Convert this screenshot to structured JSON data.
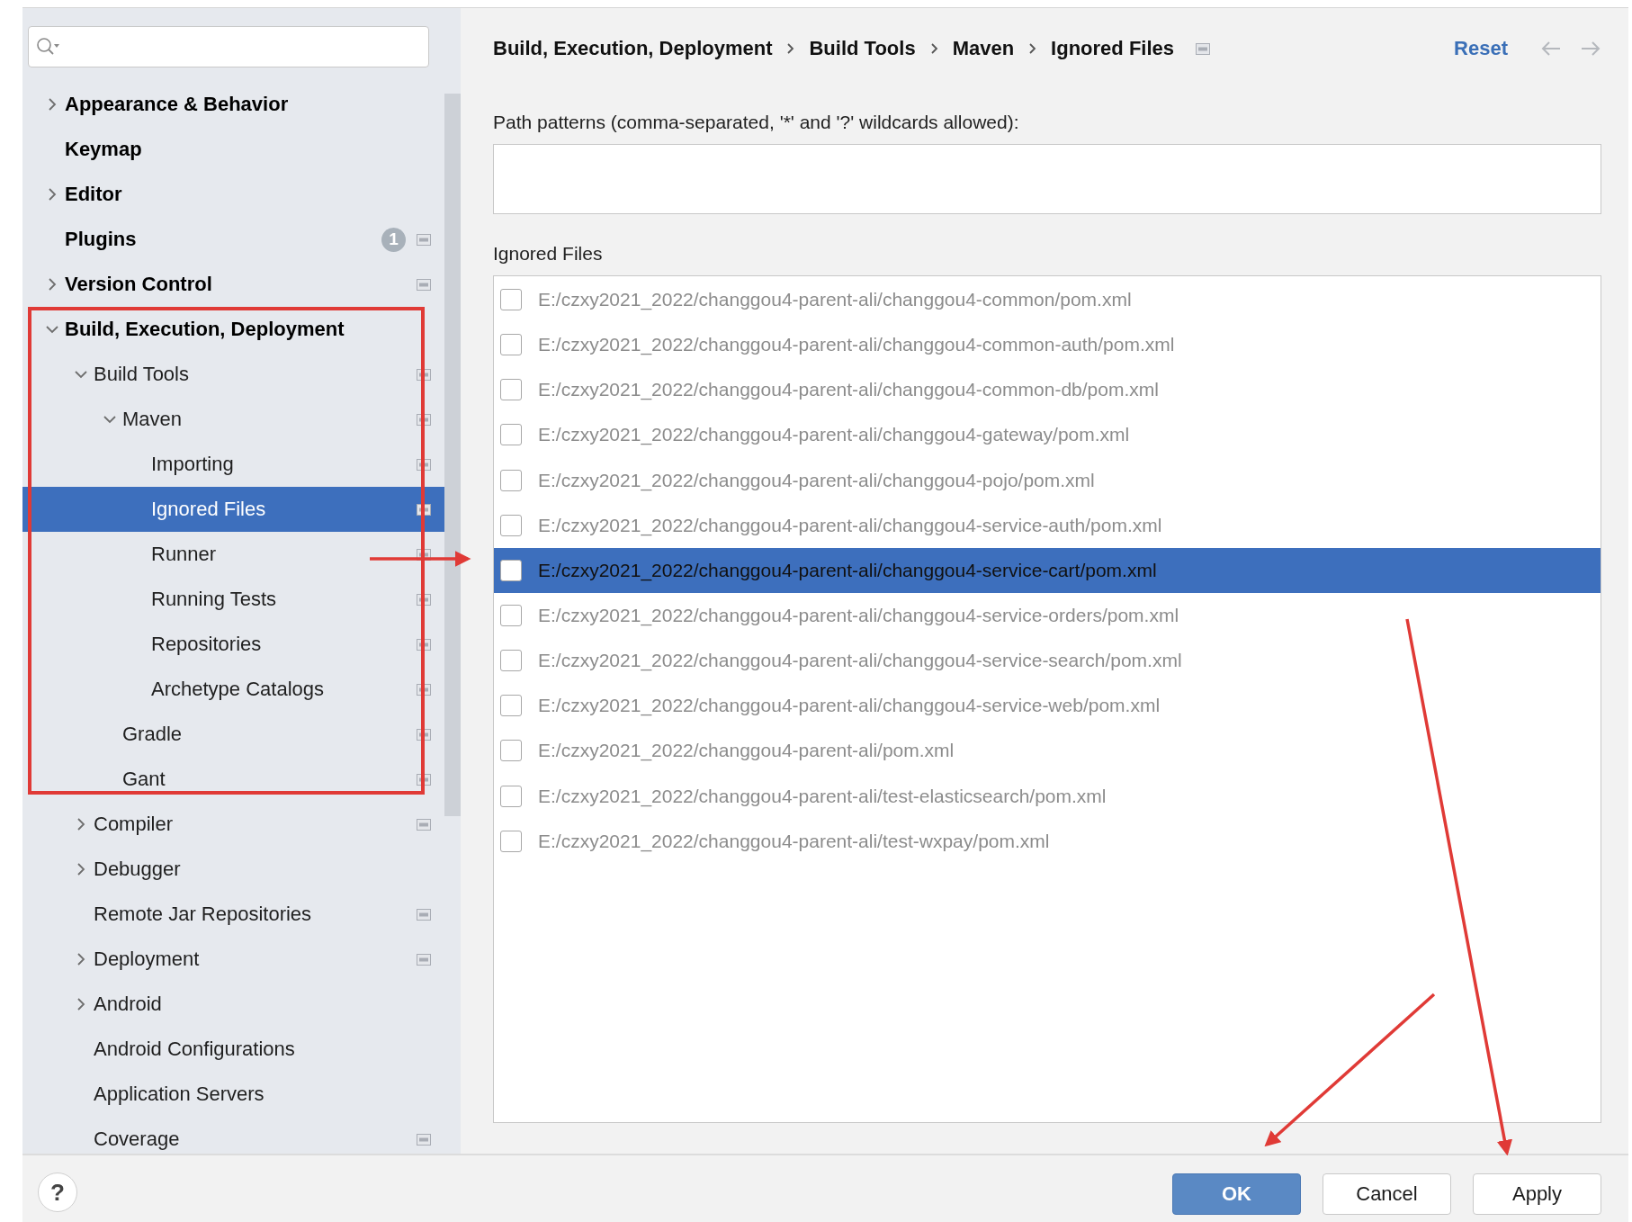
{
  "sidebar": {
    "items": [
      {
        "label": "Appearance & Behavior",
        "expanded": false,
        "selected": false,
        "project_icon": false
      },
      {
        "label": "Keymap",
        "selected": false,
        "project_icon": false
      },
      {
        "label": "Editor",
        "expanded": false,
        "selected": false,
        "project_icon": false
      },
      {
        "label": "Plugins",
        "badge": "1",
        "selected": false,
        "project_icon": true
      },
      {
        "label": "Version Control",
        "expanded": false,
        "selected": false,
        "project_icon": true
      },
      {
        "label": "Build, Execution, Deployment",
        "expanded": true,
        "selected": false,
        "project_icon": false,
        "children": [
          {
            "label": "Build Tools",
            "expanded": true,
            "selected": false,
            "project_icon": true,
            "children": [
              {
                "label": "Maven",
                "expanded": true,
                "selected": false,
                "project_icon": true,
                "children": [
                  {
                    "label": "Importing",
                    "selected": false,
                    "project_icon": true
                  },
                  {
                    "label": "Ignored Files",
                    "selected": true,
                    "project_icon": true
                  },
                  {
                    "label": "Runner",
                    "selected": false,
                    "project_icon": true
                  },
                  {
                    "label": "Running Tests",
                    "selected": false,
                    "project_icon": true
                  },
                  {
                    "label": "Repositories",
                    "selected": false,
                    "project_icon": true
                  },
                  {
                    "label": "Archetype Catalogs",
                    "selected": false,
                    "project_icon": true
                  }
                ]
              },
              {
                "label": "Gradle",
                "selected": false,
                "project_icon": true
              },
              {
                "label": "Gant",
                "selected": false,
                "project_icon": true
              }
            ]
          },
          {
            "label": "Compiler",
            "expanded": false,
            "selected": false,
            "project_icon": true
          },
          {
            "label": "Debugger",
            "expanded": false,
            "selected": false,
            "project_icon": false
          },
          {
            "label": "Remote Jar Repositories",
            "selected": false,
            "project_icon": true
          },
          {
            "label": "Deployment",
            "expanded": false,
            "selected": false,
            "project_icon": true
          },
          {
            "label": "Android",
            "expanded": false,
            "selected": false,
            "project_icon": false
          },
          {
            "label": "Android Configurations",
            "selected": false,
            "project_icon": false
          },
          {
            "label": "Application Servers",
            "selected": false,
            "project_icon": false
          },
          {
            "label": "Coverage",
            "selected": false,
            "project_icon": true
          }
        ]
      }
    ]
  },
  "breadcrumb": [
    "Build, Execution, Deployment",
    "Build Tools",
    "Maven",
    "Ignored Files"
  ],
  "header": {
    "reset": "Reset",
    "back_disabled": true,
    "forward_disabled": true
  },
  "path_patterns": {
    "label": "Path patterns (comma-separated, '*' and '?' wildcards allowed):"
  },
  "ignored_files": {
    "label": "Ignored Files",
    "rows": [
      {
        "path": "E:/czxy2021_2022/changgou4-parent-ali/changgou4-common/pom.xml",
        "checked": false,
        "selected": false
      },
      {
        "path": "E:/czxy2021_2022/changgou4-parent-ali/changgou4-common-auth/pom.xml",
        "checked": false,
        "selected": false
      },
      {
        "path": "E:/czxy2021_2022/changgou4-parent-ali/changgou4-common-db/pom.xml",
        "checked": false,
        "selected": false
      },
      {
        "path": "E:/czxy2021_2022/changgou4-parent-ali/changgou4-gateway/pom.xml",
        "checked": false,
        "selected": false
      },
      {
        "path": "E:/czxy2021_2022/changgou4-parent-ali/changgou4-pojo/pom.xml",
        "checked": false,
        "selected": false
      },
      {
        "path": "E:/czxy2021_2022/changgou4-parent-ali/changgou4-service-auth/pom.xml",
        "checked": false,
        "selected": false
      },
      {
        "path": "E:/czxy2021_2022/changgou4-parent-ali/changgou4-service-cart/pom.xml",
        "checked": false,
        "selected": true
      },
      {
        "path": "E:/czxy2021_2022/changgou4-parent-ali/changgou4-service-orders/pom.xml",
        "checked": false,
        "selected": false
      },
      {
        "path": "E:/czxy2021_2022/changgou4-parent-ali/changgou4-service-search/pom.xml",
        "checked": false,
        "selected": false
      },
      {
        "path": "E:/czxy2021_2022/changgou4-parent-ali/changgou4-service-web/pom.xml",
        "checked": false,
        "selected": false
      },
      {
        "path": "E:/czxy2021_2022/changgou4-parent-ali/pom.xml",
        "checked": false,
        "selected": false
      },
      {
        "path": "E:/czxy2021_2022/changgou4-parent-ali/test-elasticsearch/pom.xml",
        "checked": false,
        "selected": false
      },
      {
        "path": "E:/czxy2021_2022/changgou4-parent-ali/test-wxpay/pom.xml",
        "checked": false,
        "selected": false
      }
    ]
  },
  "footer": {
    "help": "?",
    "buttons": [
      {
        "label": "OK",
        "kind": "primary"
      },
      {
        "label": "Cancel",
        "kind": "normal"
      },
      {
        "label": "Apply",
        "kind": "normal"
      }
    ]
  }
}
